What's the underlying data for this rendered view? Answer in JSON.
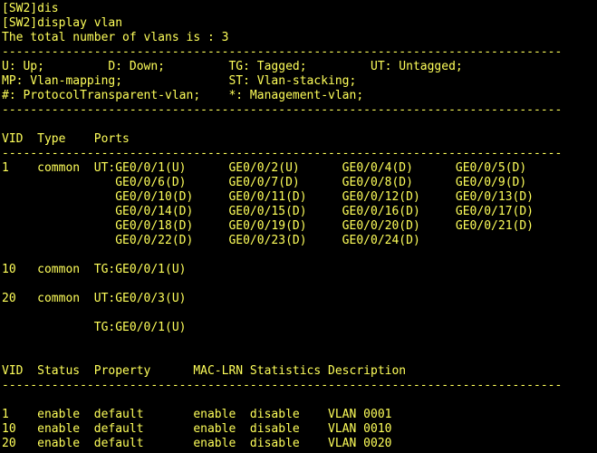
{
  "terminal": {
    "text_color": "#ffff5a",
    "background_color": "#000000",
    "lines": [
      "[SW2]dis",
      "[SW2]display vlan",
      "The total number of vlans is : 3",
      "-------------------------------------------------------------------------------",
      "U: Up;         D: Down;         TG: Tagged;         UT: Untagged;",
      "MP: Vlan-mapping;               ST: Vlan-stacking;",
      "#: ProtocolTransparent-vlan;    *: Management-vlan;",
      "-------------------------------------------------------------------------------",
      "",
      "VID  Type    Ports",
      "-------------------------------------------------------------------------------",
      "1    common  UT:GE0/0/1(U)      GE0/0/2(U)      GE0/0/4(D)      GE0/0/5(D)",
      "                GE0/0/6(D)      GE0/0/7(D)      GE0/0/8(D)      GE0/0/9(D)",
      "                GE0/0/10(D)     GE0/0/11(D)     GE0/0/12(D)     GE0/0/13(D)",
      "                GE0/0/14(D)     GE0/0/15(D)     GE0/0/16(D)     GE0/0/17(D)",
      "                GE0/0/18(D)     GE0/0/19(D)     GE0/0/20(D)     GE0/0/21(D)",
      "                GE0/0/22(D)     GE0/0/23(D)     GE0/0/24(D)",
      "",
      "10   common  TG:GE0/0/1(U)",
      "",
      "20   common  UT:GE0/0/3(U)",
      "",
      "             TG:GE0/0/1(U)",
      "",
      "",
      "VID  Status  Property      MAC-LRN Statistics Description",
      "-------------------------------------------------------------------------------",
      "",
      "1    enable  default       enable  disable    VLAN 0001",
      "10   enable  default       enable  disable    VLAN 0010",
      "20   enable  default       enable  disable    VLAN 0020"
    ]
  }
}
